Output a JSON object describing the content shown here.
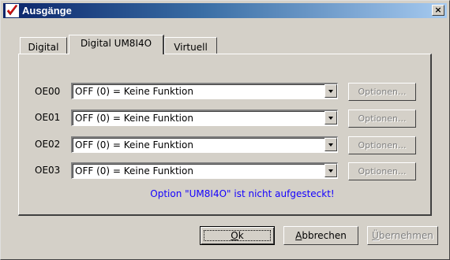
{
  "window": {
    "title": "Ausgänge",
    "close_glyph": "×",
    "app_icon": "red-checkmark-icon"
  },
  "tabs": [
    {
      "label": "Digital",
      "active": false
    },
    {
      "label": "Digital UM8I4O",
      "active": true
    },
    {
      "label": "Virtuell",
      "active": false
    }
  ],
  "outputs": [
    {
      "label": "OE00",
      "value": "OFF (0) = Keine Funktion",
      "options_label": "Optionen..."
    },
    {
      "label": "OE01",
      "value": "OFF (0) = Keine Funktion",
      "options_label": "Optionen..."
    },
    {
      "label": "OE02",
      "value": "OFF (0) = Keine Funktion",
      "options_label": "Optionen..."
    },
    {
      "label": "OE03",
      "value": "OFF (0) = Keine Funktion",
      "options_label": "Optionen..."
    }
  ],
  "notice": "Option \"UM8I4O\" ist nicht aufgesteckt!",
  "buttons": {
    "ok": {
      "accel": "O",
      "rest": "k"
    },
    "cancel": {
      "accel": "A",
      "rest": "bbrechen"
    },
    "apply": {
      "accel": "Ü",
      "rest": "bernehmen"
    }
  },
  "colors": {
    "title_start": "#0a246a",
    "title_end": "#a6caf0",
    "notice": "#1400ff",
    "face": "#d4d0c8"
  }
}
